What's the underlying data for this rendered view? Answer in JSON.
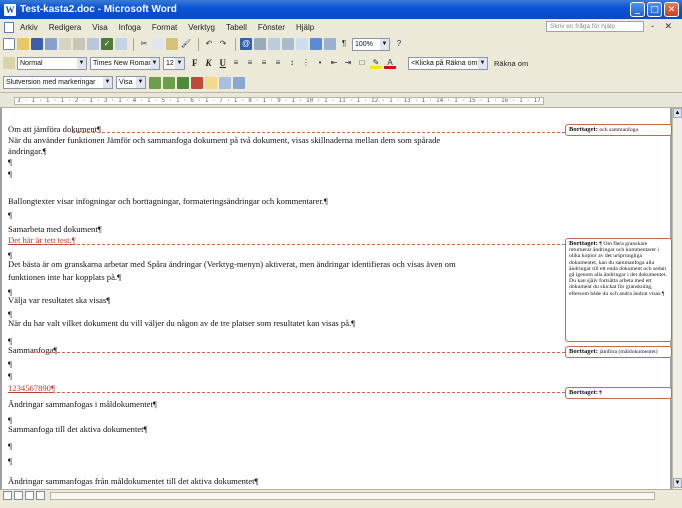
{
  "window": {
    "title": "Test-kasta2.doc - Microsoft Word",
    "controls": [
      "_",
      "□",
      "✕"
    ]
  },
  "menu": {
    "items": [
      "Arkiv",
      "Redigera",
      "Visa",
      "Infoga",
      "Format",
      "Verktyg",
      "Tabell",
      "Fönster",
      "Hjälp"
    ],
    "help_placeholder": "Skriv en fråga för hjälp",
    "right": "- ✕"
  },
  "toolbar_formatting": {
    "style": "Normal",
    "font": "Times New Roman",
    "size": "12",
    "bold": "F",
    "italic": "K",
    "underline": "U",
    "zoom": "100%",
    "lookup": "<Klicka på Räkna om>",
    "recalc": "Räkna om"
  },
  "toolbar_review": {
    "display_mode": "Slutversion med markeringar",
    "show": "Visa"
  },
  "ruler": {
    "text": "3 · 1 · 1 · 1 · 2 · 1 · 3 · 1 · 4 · 1 · 5 · 1 · 6 · 1 · 7 · 1 · 8 · 1 · 9 · 1 · 10 · 1 · 11 · 1 · 12 · 1 · 13 · 1 · 14 · 1 · 15 · 1 · 16 · 1 · 17 · 1 · 18 · 1 · 19 · 1 · 20 · 1"
  },
  "document": {
    "lines": [
      "Om att jämföra dokument¶",
      "När du använder funktionen Jämför och sammanfoga dokument på två dokument, visas skillnaderna mellan dem som spårade",
      "ändringar.¶",
      "¶",
      "¶",
      "Ballongtexter visar infogningar och borttagningar, formateringsändringar och kommentarer.¶",
      "¶",
      "Samarbeta med dokument¶",
      "Det här är tett test.¶",
      "¶",
      "Det bästa är om granskarna arbetar med Spåra ändringar (Verktyg-menyn) aktiverat, men ändringar identifieras och visas även om",
      "funktionen inte har kopplats på.¶",
      "¶",
      "Välja var resultatet ska visas¶",
      "¶",
      "När du har valt vilket dokument du vill väljer du någon av de tre platser som resultatet kan visas på.¶",
      "¶",
      "Sammanfoga¶",
      "¶",
      "¶",
      "1234567890¶",
      "  Ändringar sammanfogas i måldokumentet¶",
      "¶",
      "Sammanfoga till det aktiva dokumentet¶",
      "¶",
      "¶",
      "  Ändringar sammanfogas från måldokumentet till det aktiva dokumentet¶"
    ],
    "inserted_lines": [
      8,
      20
    ]
  },
  "balloons": [
    {
      "label": "Borttaget:",
      "text": "och sammanfoga"
    },
    {
      "label": "Borttaget:",
      "text": "¶ Om flera granskare returnerar ändringar och kommentarer i olika kopior av det ursprungliga dokumentet, kan du sammanfoga alla ändringar till ett enda dokument och sedan gå igenom alla ändringar i det dokumentet. Du kan själv fortsätta arbeta med ett dokument du skickat för granskning, eftersom både du och andra ändrat visas.¶"
    },
    {
      "label": "Borttaget:",
      "text": "jämföra (måldokumentet)"
    },
    {
      "label": "Borttaget:",
      "text": "¶"
    }
  ]
}
